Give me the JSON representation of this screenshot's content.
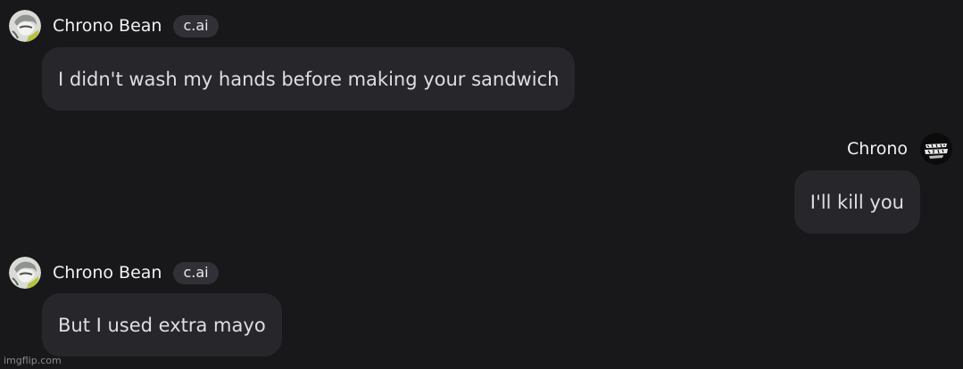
{
  "messages": [
    {
      "sender": "Chrono Bean",
      "badge": "c.ai",
      "text": "I didn't wash my hands before making your sandwich",
      "avatar": "character-avatar"
    },
    {
      "sender": "Chrono",
      "text": "I'll kill you",
      "avatar": "user-avatar"
    },
    {
      "sender": "Chrono Bean",
      "badge": "c.ai",
      "text": "But I used extra mayo",
      "avatar": "character-avatar"
    }
  ],
  "watermark": "imgflip.com",
  "colors": {
    "background": "#18181b",
    "bubble": "#26262b",
    "badge": "#303036",
    "name": "#f1f1f3",
    "message_text": "#dedee3"
  }
}
